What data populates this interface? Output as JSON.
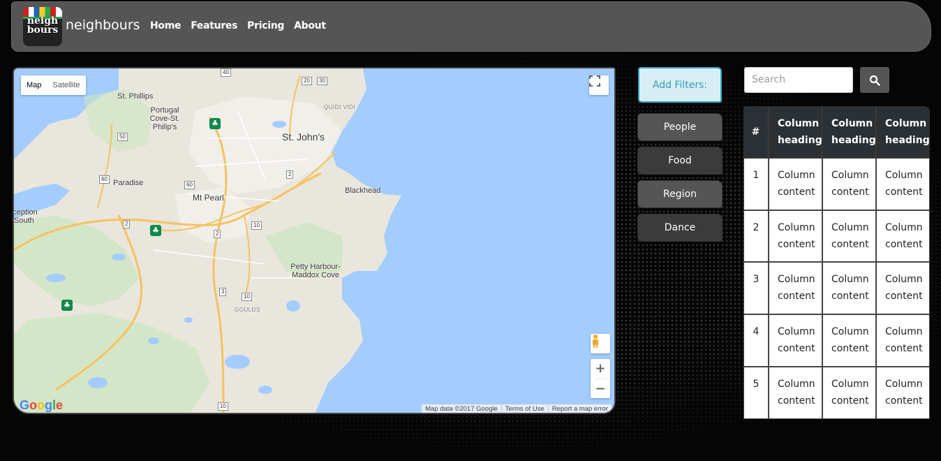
{
  "navbar": {
    "logo_text": "neigh bours",
    "brand": "neighbours",
    "links": [
      "Home",
      "Features",
      "Pricing",
      "About"
    ]
  },
  "map": {
    "type_map": "Map",
    "type_satellite": "Satellite",
    "labels": {
      "st_johns": "St. John's",
      "st_phillips": "St. Phillips",
      "portugal_cove": "Portugal Cove-St. Philip's",
      "paradise": "Paradise",
      "mt_pearl": "Mt Pearl",
      "blackhead": "Blackhead",
      "petty_harbour": "Petty Harbour-Maddox Cove",
      "conception_south": "Conception Bay South",
      "quidi_vidi": "QUIDI VIDI",
      "goulds": "GOULDS"
    },
    "routes": [
      "40",
      "20",
      "30",
      "50",
      "60",
      "60",
      "2",
      "2",
      "2",
      "10",
      "3",
      "10",
      "10"
    ],
    "google": "Google",
    "attribution": [
      "Map data ©2017 Google",
      "Terms of Use",
      "Report a map error"
    ]
  },
  "filters": {
    "add_label": "Add Filters:",
    "items": [
      "People",
      "Food",
      "Region",
      "Dance"
    ]
  },
  "search": {
    "placeholder": "Search",
    "icon": "search-icon"
  },
  "table": {
    "headers": [
      "#",
      "Column heading",
      "Column heading",
      "Column heading"
    ],
    "rows": [
      [
        "1",
        "Column content",
        "Column content",
        "Column content"
      ],
      [
        "2",
        "Column content",
        "Column content",
        "Column content"
      ],
      [
        "3",
        "Column content",
        "Column content",
        "Column content"
      ],
      [
        "4",
        "Column content",
        "Column content",
        "Column content"
      ],
      [
        "5",
        "Column content",
        "Column content",
        "Column content"
      ]
    ]
  },
  "colors": {
    "navbar": "#555555",
    "accent": "#2ea8c2",
    "water": "#a3ccff",
    "land": "#e8e6dd"
  }
}
